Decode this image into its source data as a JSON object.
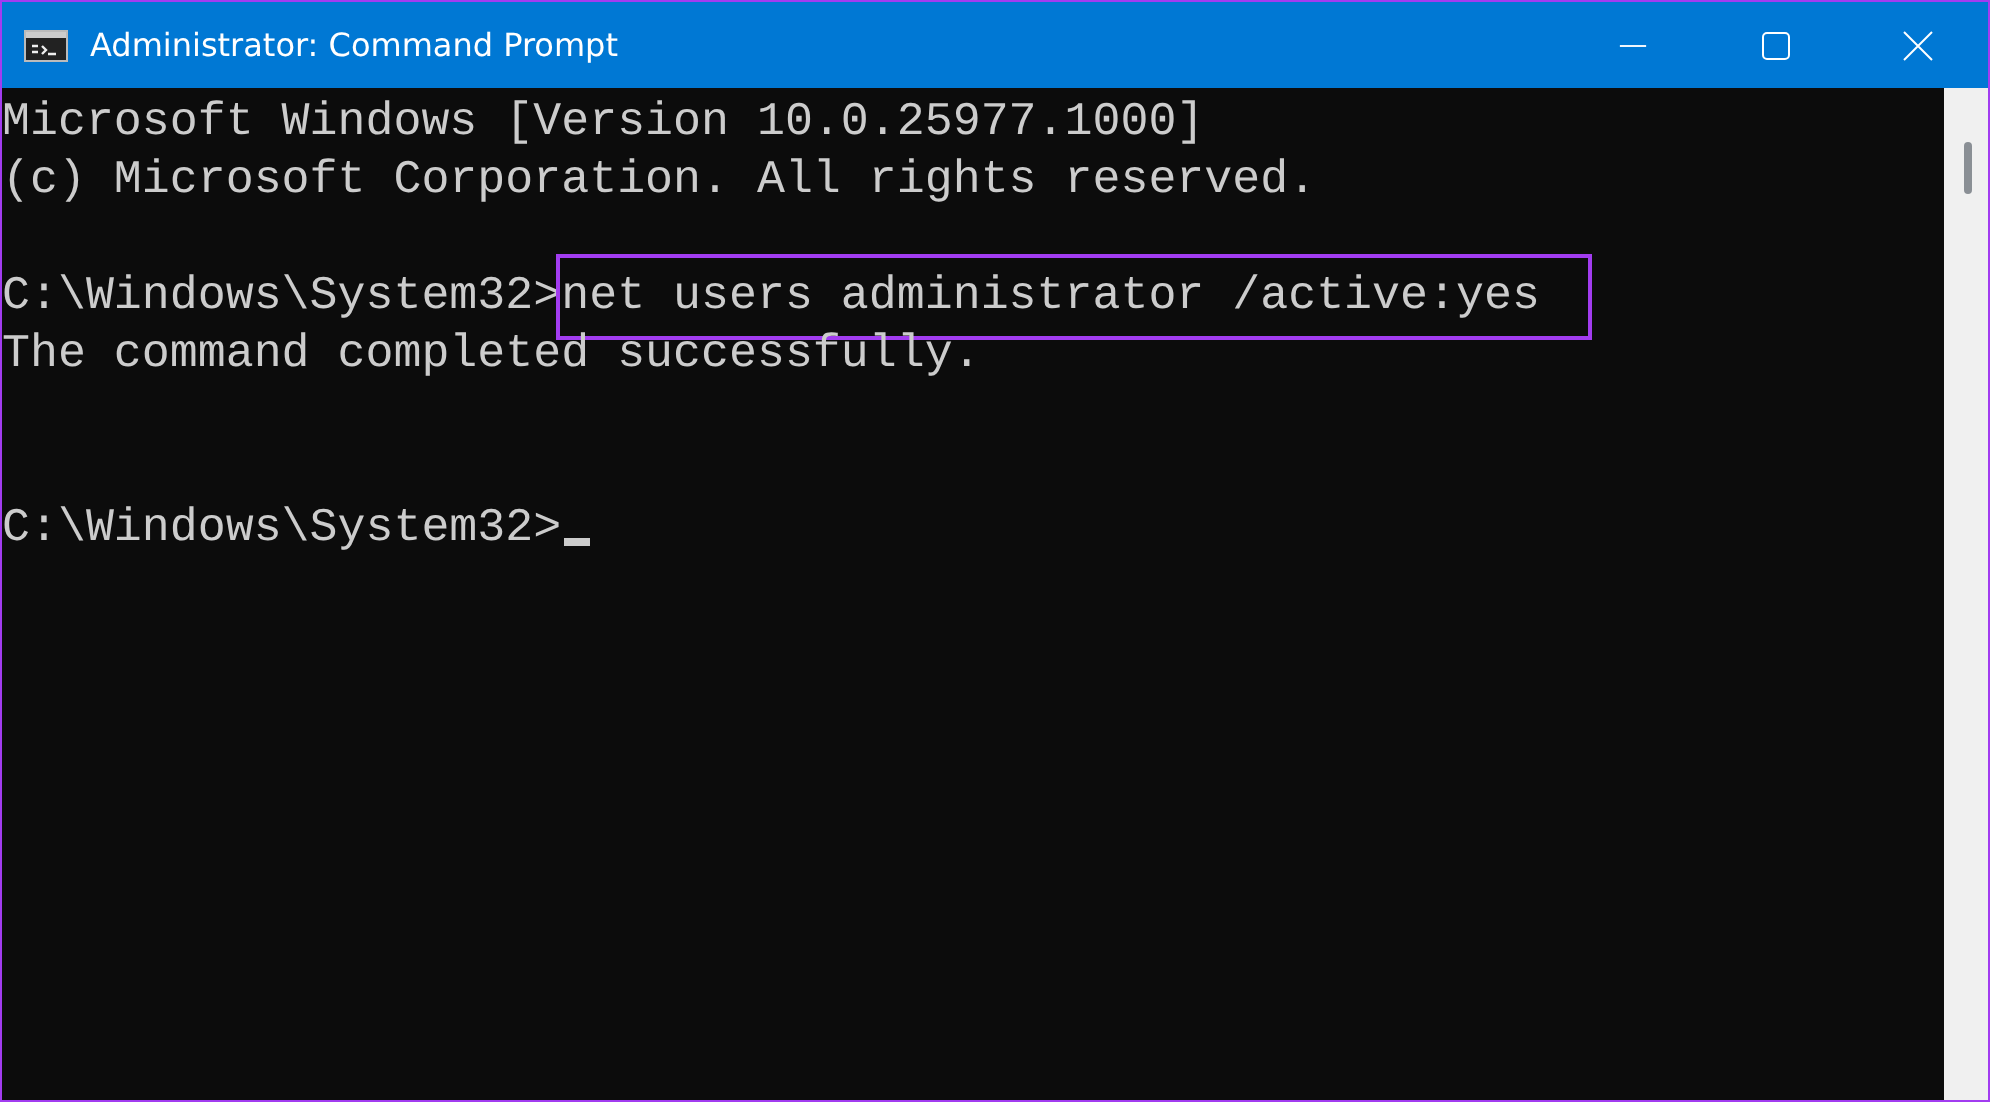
{
  "window": {
    "title": "Administrator: Command Prompt"
  },
  "lines": [
    {
      "kind": "text",
      "text": "Microsoft Windows [Version 10.0.25977.1000]"
    },
    {
      "kind": "text",
      "text": "(c) Microsoft Corporation. All rights reserved."
    },
    {
      "kind": "blank"
    },
    {
      "kind": "command",
      "prompt": "C:\\Windows\\System32>",
      "command": "net users administrator /active:yes",
      "highlighted": true
    },
    {
      "kind": "text",
      "text": "The command completed successfully."
    },
    {
      "kind": "blank"
    },
    {
      "kind": "blank"
    },
    {
      "kind": "input",
      "prompt": "C:\\Windows\\System32>",
      "cursor": true
    }
  ]
}
